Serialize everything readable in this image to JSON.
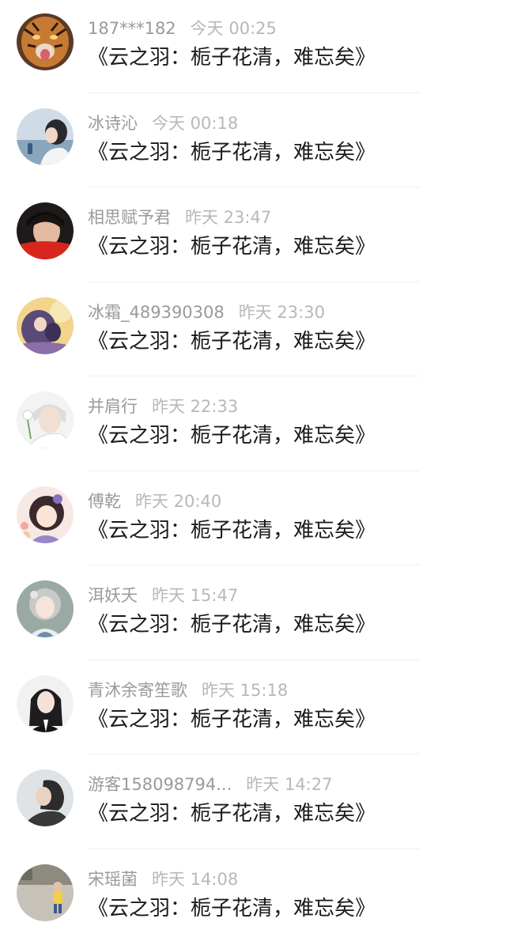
{
  "messages": [
    {
      "name": "187***182",
      "time": "今天 00:25",
      "text": "《云之羽：栀子花清，难忘矣》",
      "avatar_icon": "tiger-avatar-icon"
    },
    {
      "name": "冰诗沁",
      "time": "今天 00:18",
      "text": "《云之羽：栀子花清，难忘矣》",
      "avatar_icon": "girl-by-sea-avatar-icon"
    },
    {
      "name": "相思赋予君",
      "time": "昨天 23:47",
      "text": "《云之羽：栀子花清，难忘矣》",
      "avatar_icon": "man-red-fan-avatar-icon"
    },
    {
      "name": "冰霜_489390308",
      "time": "昨天 23:30",
      "text": "《云之羽：栀子花清，难忘矣》",
      "avatar_icon": "couple-illustration-avatar-icon"
    },
    {
      "name": "并肩行",
      "time": "昨天 22:33",
      "text": "《云之羽：栀子花清，难忘矣》",
      "avatar_icon": "boy-with-flower-avatar-icon"
    },
    {
      "name": "傅乾",
      "time": "昨天 20:40",
      "text": "《云之羽：栀子花清，难忘矣》",
      "avatar_icon": "cartoon-girl-avatar-icon"
    },
    {
      "name": "洱妖夭",
      "time": "昨天 15:47",
      "text": "《云之羽：栀子花清，难忘矣》",
      "avatar_icon": "anime-girl-avatar-icon"
    },
    {
      "name": "青沐余寄笙歌",
      "time": "昨天 15:18",
      "text": "《云之羽：栀子花清，难忘矣》",
      "avatar_icon": "dark-hair-girl-avatar-icon"
    },
    {
      "name": "游客158098794...",
      "time": "昨天 14:27",
      "text": "《云之羽：栀子花清，难忘矣》",
      "avatar_icon": "person-profile-avatar-icon"
    },
    {
      "name": "宋瑶菌",
      "time": "昨天 14:08",
      "text": "《云之羽：栀子花清，难忘矣》",
      "avatar_icon": "child-outdoors-avatar-icon"
    }
  ]
}
